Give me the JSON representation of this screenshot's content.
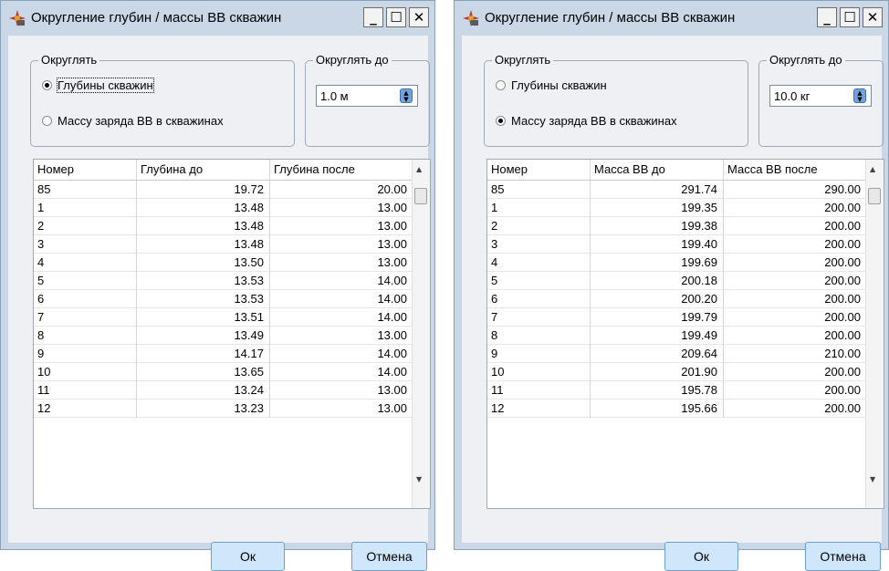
{
  "window1": {
    "title": "Округление глубин / массы ВВ скважин",
    "round_group": {
      "title": "Округлять",
      "options": [
        {
          "label": "Глубины скважин",
          "selected": true
        },
        {
          "label": "Массу заряда ВВ в скважинах",
          "selected": false
        }
      ]
    },
    "round_to_group": {
      "title": "Округлять до",
      "value": "1.0 м"
    },
    "table": {
      "columns": [
        "Номер",
        "Глубина до",
        "Глубина после"
      ],
      "rows": [
        [
          "85",
          "19.72",
          "20.00"
        ],
        [
          "1",
          "13.48",
          "13.00"
        ],
        [
          "2",
          "13.48",
          "13.00"
        ],
        [
          "3",
          "13.48",
          "13.00"
        ],
        [
          "4",
          "13.50",
          "13.00"
        ],
        [
          "5",
          "13.53",
          "14.00"
        ],
        [
          "6",
          "13.53",
          "14.00"
        ],
        [
          "7",
          "13.51",
          "14.00"
        ],
        [
          "8",
          "13.49",
          "13.00"
        ],
        [
          "9",
          "14.17",
          "14.00"
        ],
        [
          "10",
          "13.65",
          "14.00"
        ],
        [
          "11",
          "13.24",
          "13.00"
        ],
        [
          "12",
          "13.23",
          "13.00"
        ]
      ]
    },
    "ok_label": "Ок",
    "cancel_label": "Отмена"
  },
  "window2": {
    "title": "Округление глубин / массы ВВ скважин",
    "round_group": {
      "title": "Округлять",
      "options": [
        {
          "label": "Глубины скважин",
          "selected": false
        },
        {
          "label": "Массу заряда ВВ в скважинах",
          "selected": true
        }
      ]
    },
    "round_to_group": {
      "title": "Округлять до",
      "value": "10.0 кг"
    },
    "table": {
      "columns": [
        "Номер",
        "Масса ВВ до",
        "Масса ВВ после"
      ],
      "rows": [
        [
          "85",
          "291.74",
          "290.00"
        ],
        [
          "1",
          "199.35",
          "200.00"
        ],
        [
          "2",
          "199.38",
          "200.00"
        ],
        [
          "3",
          "199.40",
          "200.00"
        ],
        [
          "4",
          "199.69",
          "200.00"
        ],
        [
          "5",
          "200.18",
          "200.00"
        ],
        [
          "6",
          "200.20",
          "200.00"
        ],
        [
          "7",
          "199.79",
          "200.00"
        ],
        [
          "8",
          "199.49",
          "200.00"
        ],
        [
          "9",
          "209.64",
          "210.00"
        ],
        [
          "10",
          "201.90",
          "200.00"
        ],
        [
          "11",
          "195.78",
          "200.00"
        ],
        [
          "12",
          "195.66",
          "200.00"
        ]
      ]
    },
    "ok_label": "Ок",
    "cancel_label": "Отмена"
  },
  "caption_buttons": {
    "minimize": "_",
    "maximize": "☐",
    "close": "✕"
  },
  "colors": {
    "window_frame": "#c9d7e6",
    "client_bg": "#eef0f3",
    "button_bg": "#cfe6fb",
    "spin_accent": "#6fa4de"
  }
}
